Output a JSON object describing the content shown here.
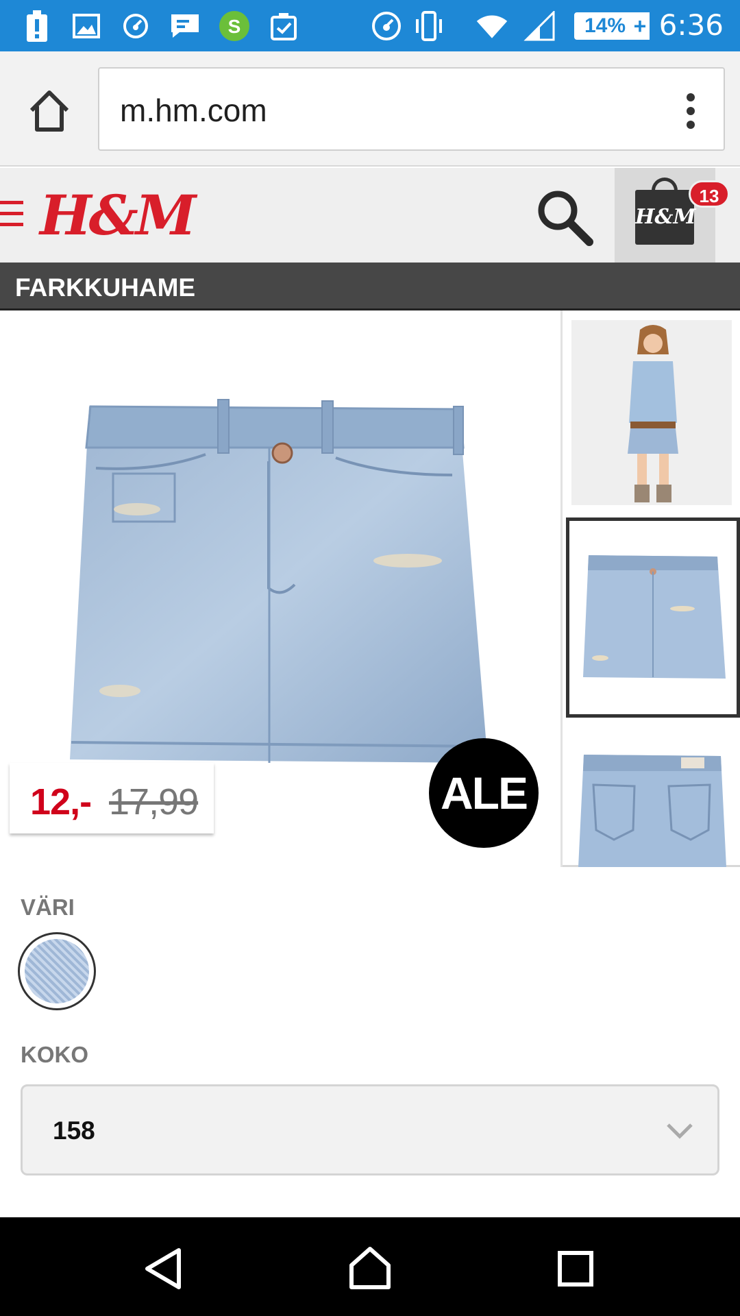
{
  "status_bar": {
    "time": "6:36",
    "battery": "14%",
    "battery_plus": "+",
    "icons": [
      "alert-icon",
      "image-icon",
      "speedometer-icon",
      "message-icon",
      "s-app-icon",
      "clipboard-icon",
      "speedometer-icon",
      "vibrate-icon",
      "wifi-icon",
      "signal-icon"
    ]
  },
  "browser": {
    "url": "m.hm.com"
  },
  "header": {
    "logo": "H&M",
    "bag_logo": "H&M",
    "bag_count": "13"
  },
  "product": {
    "title": "FARKKUHAME",
    "price_new": "12,-",
    "price_old": "17,99",
    "sale_badge": "ALE"
  },
  "options": {
    "color_label": "VÄRI",
    "size_label": "KOKO",
    "size_value": "158"
  },
  "colors": {
    "status_bar": "#1e88d6",
    "brand_red": "#d81e2a",
    "price_red": "#d0021b",
    "title_bar": "#474747"
  }
}
